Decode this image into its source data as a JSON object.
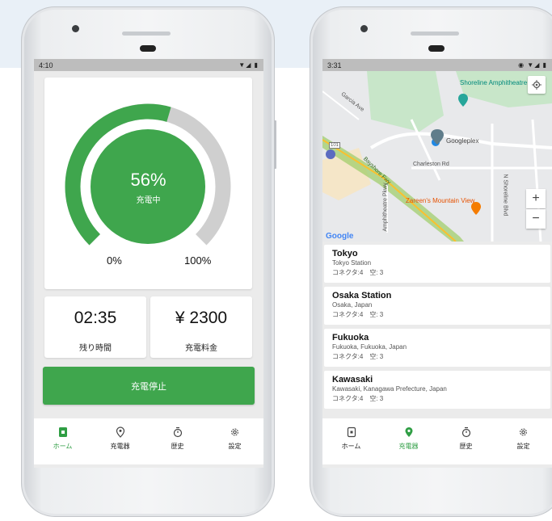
{
  "left": {
    "status": {
      "time": "4:10",
      "icons": "▼◢ ▮"
    },
    "gauge": {
      "percent_text": "56%",
      "state": "充電中",
      "label_min": "0%",
      "label_max": "100%",
      "percent": 56
    },
    "remaining": {
      "value": "02:35",
      "label": "残り時間"
    },
    "fee": {
      "value": "¥ 2300",
      "label": "充電料金"
    },
    "stop_button": "充電停止",
    "nav": [
      {
        "label": "ホーム",
        "icon": "home-icon",
        "active": true
      },
      {
        "label": "充電器",
        "icon": "location-pin-icon",
        "active": false
      },
      {
        "label": "歴史",
        "icon": "stopwatch-icon",
        "active": false
      },
      {
        "label": "設定",
        "icon": "gear-icon",
        "active": false
      }
    ]
  },
  "right": {
    "status": {
      "time": "3:31",
      "icons": "◉ ▼◢ ▮"
    },
    "map": {
      "pois": [
        "Shoreline Amphitheatre",
        "Googleplex",
        "Zareen's Mountain View"
      ],
      "streets": [
        "Garcia Ave",
        "Charleston Rd",
        "Bayshore Fwy",
        "Amphitheatre Pkwy",
        "N Shoreline Blvd",
        "101"
      ],
      "zoom_in": "+",
      "zoom_out": "−",
      "logo": "Google"
    },
    "stations": [
      {
        "name": "Tokyo",
        "address": "Tokyo Station",
        "connectors": "コネクタ:4　空: 3"
      },
      {
        "name": "Osaka Station",
        "address": "Osaka, Japan",
        "connectors": "コネクタ:4　空: 3"
      },
      {
        "name": "Fukuoka",
        "address": "Fukuoka, Fukuoka, Japan",
        "connectors": "コネクタ:4　空: 3"
      },
      {
        "name": "Kawasaki",
        "address": "Kawasaki, Kanagawa Prefecture, Japan",
        "connectors": "コネクタ:4　空: 3"
      }
    ],
    "nav": [
      {
        "label": "ホーム",
        "icon": "home-icon",
        "active": false
      },
      {
        "label": "充電器",
        "icon": "location-pin-icon",
        "active": true
      },
      {
        "label": "歴史",
        "icon": "stopwatch-icon",
        "active": false
      },
      {
        "label": "設定",
        "icon": "gear-icon",
        "active": false
      }
    ]
  },
  "colors": {
    "accent": "#3fa64d",
    "track": "#cfcfcf",
    "active_nav": "#2f9e44"
  }
}
